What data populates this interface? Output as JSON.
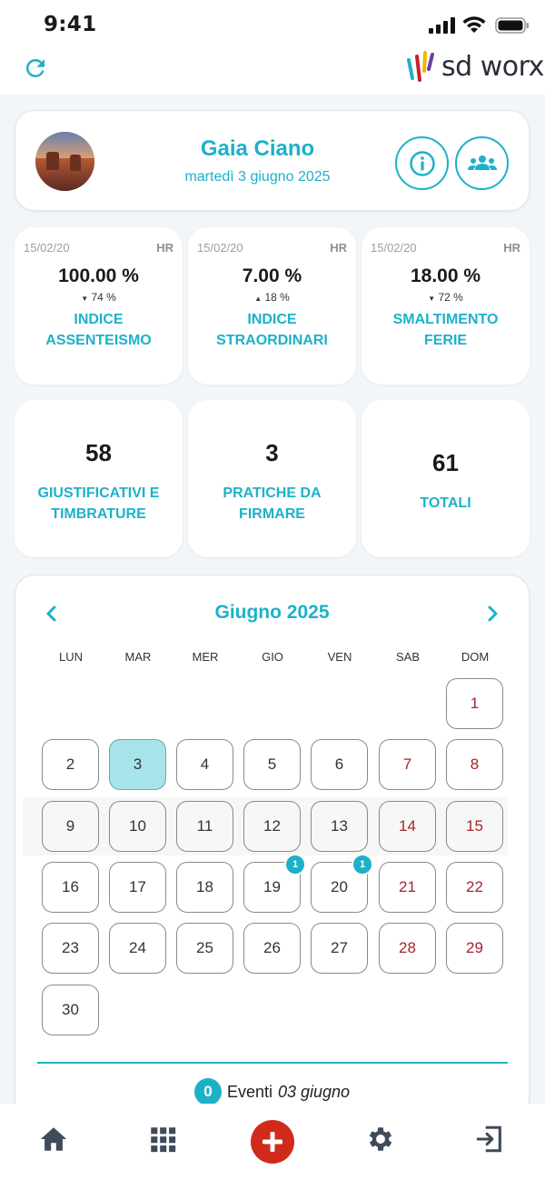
{
  "status": {
    "time": "9:41"
  },
  "header": {
    "logo_text": "sd worx",
    "accent": "#1db1c9"
  },
  "profile": {
    "name": "Gaia Ciano",
    "date": "martedì 3 giugno 2025"
  },
  "kpis": [
    {
      "date": "15/02/20",
      "tag": "HR",
      "value": "100.00 %",
      "trend_dir": "down",
      "trend": "74 %",
      "label1": "INDICE",
      "label2": "ASSENTEISMO"
    },
    {
      "date": "15/02/20",
      "tag": "HR",
      "value": "7.00 %",
      "trend_dir": "up",
      "trend": "18 %",
      "label1": "INDICE",
      "label2": "STRAORDINARI"
    },
    {
      "date": "15/02/20",
      "tag": "HR",
      "value": "18.00 %",
      "trend_dir": "down",
      "trend": "72 %",
      "label1": "SMALTIMENTO",
      "label2": "FERIE"
    }
  ],
  "counters": [
    {
      "number": "58",
      "label1": "GIUSTIFICATIVI E",
      "label2": "TIMBRATURE"
    },
    {
      "number": "3",
      "label1": "PRATICHE DA",
      "label2": "FIRMARE"
    },
    {
      "number": "61",
      "label1": "TOTALI",
      "label2": ""
    }
  ],
  "calendar": {
    "month": "Giugno 2025",
    "weekdays": [
      "LUN",
      "MAR",
      "MER",
      "GIO",
      "VEN",
      "SAB",
      "DOM"
    ],
    "first_weekday_index": 6,
    "days_in_month": 30,
    "selected_day": 3,
    "badges": {
      "19": "1",
      "20": "1"
    },
    "events_count": "0",
    "events_label": "Eventi",
    "events_date": "03 giugno"
  }
}
